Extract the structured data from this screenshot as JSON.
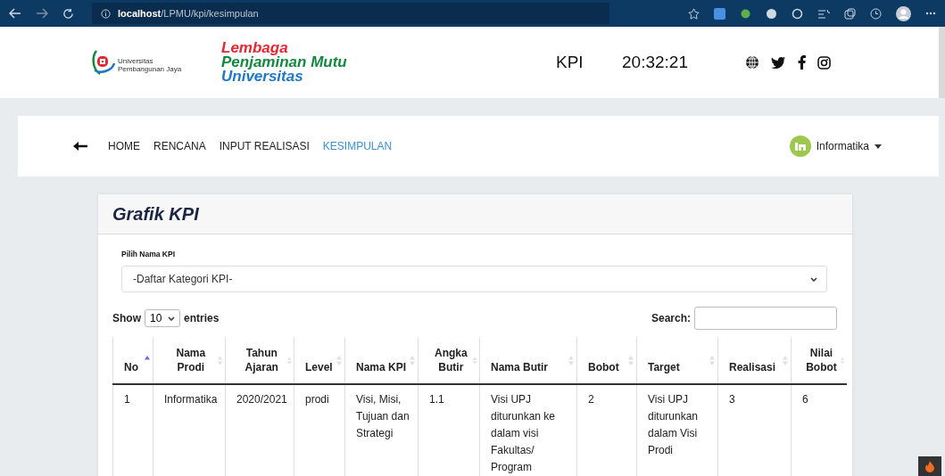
{
  "browser": {
    "address": "**localhost**/LPMU/kpi/kesimpulan"
  },
  "header": {
    "logo_caption": "Universitas Pembangunan Jaya",
    "title_lines": [
      {
        "text": "Lembaga",
        "color": "#e8262f"
      },
      {
        "text": "Penjaminan Mutu",
        "color": "#0f8a3e"
      },
      {
        "text": "Universitas",
        "color": "#1e78c8"
      }
    ],
    "app": "KPI",
    "time": "20:32:21"
  },
  "nav": {
    "items": [
      {
        "label": "HOME",
        "selected": false
      },
      {
        "label": "RENCANA",
        "selected": false
      },
      {
        "label": "INPUT REALISASI",
        "selected": false
      },
      {
        "label": "KESIMPULAN",
        "selected": true
      }
    ],
    "user": "Informatika"
  },
  "card": {
    "title": "Grafik KPI",
    "select_label": "Pilih Nama KPI",
    "select_value": "-Daftar Kategori KPI-",
    "show_label": "Show",
    "page_size": "10",
    "entries_label": "entries",
    "search_label": "Search:"
  },
  "table": {
    "columns": [
      {
        "label": "No",
        "sorted": true
      },
      {
        "label": "Nama Prodi",
        "sorted": false
      },
      {
        "label": "Tahun Ajaran",
        "sorted": false
      },
      {
        "label": "Level",
        "sorted": false
      },
      {
        "label": "Nama KPI",
        "sorted": false
      },
      {
        "label": "Angka Butir",
        "sorted": false
      },
      {
        "label": "Nama Butir",
        "sorted": false
      },
      {
        "label": "Bobot",
        "sorted": false
      },
      {
        "label": "Target",
        "sorted": false
      },
      {
        "label": "Realisasi",
        "sorted": false
      },
      {
        "label": "Nilai Bobot",
        "sorted": false
      }
    ],
    "rows": [
      [
        "1",
        "Informatika",
        "2020/2021",
        "prodi",
        "Visi, Misi, Tujuan dan Strategi",
        "1.1",
        "Visi UPJ diturunkan ke dalam visi Fakultas/ Program",
        "2",
        "Visi UPJ diturunkan dalam Visi Prodi",
        "3",
        "6"
      ]
    ]
  }
}
